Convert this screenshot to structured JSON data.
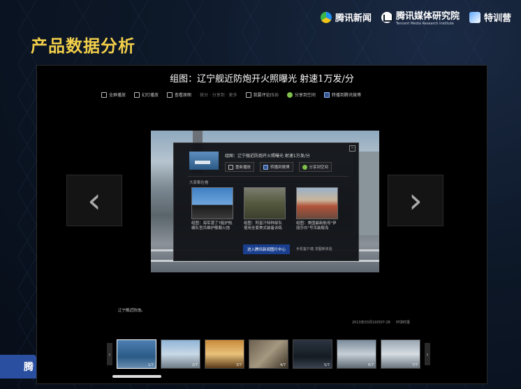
{
  "slide": {
    "title": "产品数据分析",
    "corner_text": "腾"
  },
  "logos": [
    {
      "name": "腾讯新闻"
    },
    {
      "name": "腾讯媒体研究院",
      "sub": "Tencent Media Research Institute"
    },
    {
      "name": "特训营"
    }
  ],
  "player": {
    "title": "组图：辽宁舰近防炮开火照曝光 射速1万发/分",
    "toolbar": {
      "fullscreen": "全屏播放",
      "slideshow": "幻灯播放",
      "original": "查看原图",
      "select_placeholder": "按分 · 分享到 · 更多",
      "comments": "我要评论(53)",
      "share_qzone": "分享到空间",
      "share_weibo": "转播到腾讯微博"
    },
    "nav": {
      "prev": "‹",
      "next": "›"
    },
    "overlay": {
      "close": "×",
      "title": "组图：辽宁舰近防炮开火照曝光 射速1万发/分",
      "replay": "重新播放",
      "weibo": "转播到微博",
      "qzone": "分享到空间",
      "rec_heading": "大家都在看",
      "recs": [
        {
          "caption": "组图：海军潜了7艇护航编队官兵维护舰载火炮"
        },
        {
          "caption": "组图：阿富汗特种部队使用全套美式装备训练"
        },
        {
          "caption": "组图：美国最新航母\"伊丽莎白\"号吊装舰岛"
        }
      ],
      "cta": "进入腾讯新闻图片中心",
      "links": "手机客户端  求图新体验"
    },
    "caption": "辽宁舰近防炮。",
    "meta": {
      "date": "2013年03月19日07:28",
      "source": "环球时报"
    },
    "strip": {
      "left_arrow": "‹",
      "right_arrow": "›",
      "thumbs": [
        {
          "n": "1/7"
        },
        {
          "n": "2/7"
        },
        {
          "n": "3/7"
        },
        {
          "n": "4/7"
        },
        {
          "n": "5/7"
        },
        {
          "n": "6/7"
        },
        {
          "n": "7/7"
        }
      ]
    }
  }
}
